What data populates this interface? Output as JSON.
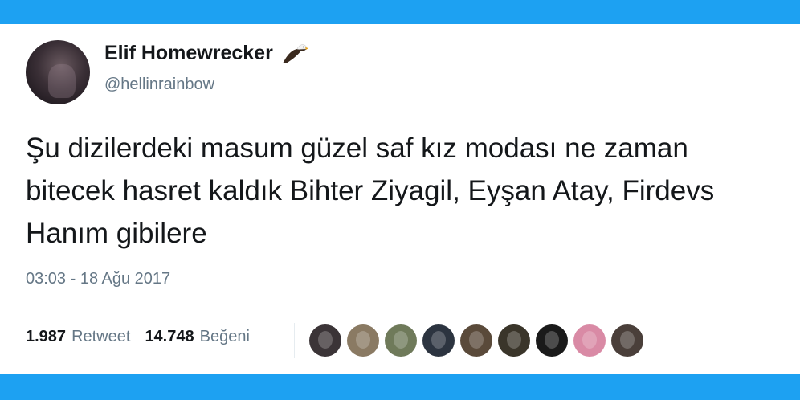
{
  "tweet": {
    "display_name": "Elif Homewrecker",
    "badge_icon": "eagle-icon",
    "handle": "@hellinrainbow",
    "text": "Şu dizilerdeki masum güzel saf kız modası ne zaman bitecek hasret kaldık Bihter Ziyagil, Eyşan Atay, Firdevs Hanım gibilere",
    "timestamp": "03:03 - 18 Ağu 2017",
    "retweet_count": "1.987",
    "retweet_label": "Retweet",
    "like_count": "14.748",
    "like_label": "Beğeni"
  },
  "colors": {
    "accent": "#1da1f2",
    "text_primary": "#14171a",
    "text_secondary": "#657786",
    "divider": "#e6ecf0"
  },
  "liker_avatars": [
    {
      "color": "#3b3437"
    },
    {
      "color": "#8a7a63"
    },
    {
      "color": "#6f7a5a"
    },
    {
      "color": "#2c3440"
    },
    {
      "color": "#5a4a3a"
    },
    {
      "color": "#3a352a"
    },
    {
      "color": "#1a1a1a"
    },
    {
      "color": "#d98aa5"
    },
    {
      "color": "#4a3f3a"
    }
  ]
}
